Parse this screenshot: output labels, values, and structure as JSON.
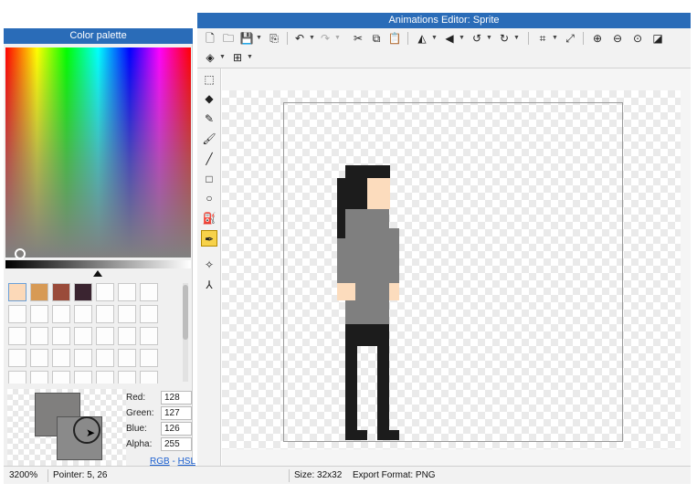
{
  "window": {
    "title": "Animations Editor: Sprite"
  },
  "palette": {
    "title": "Color palette",
    "swatches": [
      "#fcd9b8",
      "#d79a55",
      "#9a4b3a",
      "#3a2430"
    ],
    "empty_swatch_count": 31,
    "selected_color": "#807f7e",
    "red_label": "Red:",
    "red_value": "128",
    "green_label": "Green:",
    "green_value": "127",
    "blue_label": "Blue:",
    "blue_value": "126",
    "alpha_label": "Alpha:",
    "alpha_value": "255",
    "rgb_link": "RGB",
    "separator": " - ",
    "hsl_link": "HSL"
  },
  "toolbar": {
    "icons": [
      "new-file-icon",
      "open-folder-icon",
      "save-icon",
      "export-icon",
      "undo-icon",
      "redo-icon",
      "cut-icon",
      "copy-icon",
      "paste-icon",
      "flip-horizontal-icon",
      "flip-vertical-icon",
      "rotate-left-icon",
      "rotate-right-icon",
      "crop-icon",
      "resize-icon",
      "zoom-in-icon",
      "zoom-out-icon",
      "zoom-fit-icon",
      "invert-icon",
      "layers-icon",
      "grid-icon"
    ]
  },
  "tools": {
    "active": "eyedropper",
    "items": [
      "select",
      "eraser",
      "pencil",
      "brush",
      "line",
      "rectangle",
      "ellipse",
      "fill",
      "eyedropper",
      "move-point",
      "path"
    ]
  },
  "canvas": {
    "colors": {
      "hair": "#1c1c1c",
      "skin": "#fcdcbd",
      "shirt": "#7f7f7f",
      "pants": "#1c1c1c"
    }
  },
  "status": {
    "zoom": "3200%",
    "pointer": "Pointer: 5, 26",
    "size": "Size: 32x32",
    "format": "Export Format: PNG"
  }
}
